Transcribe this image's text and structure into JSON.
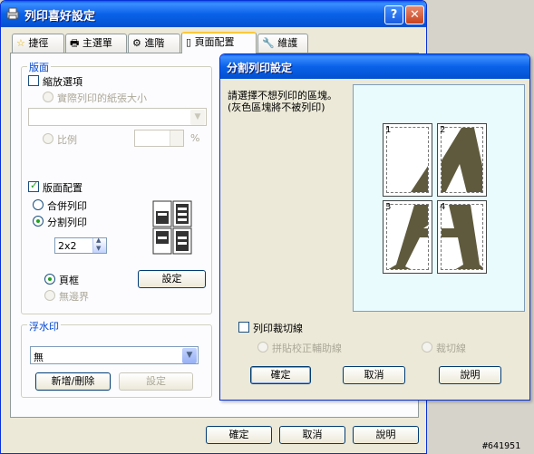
{
  "main_window": {
    "title": "列印喜好設定",
    "tabs": [
      "捷徑",
      "主選單",
      "進階",
      "頁面配置",
      "維護"
    ],
    "layout_group": {
      "title": "版面",
      "scale_option": "縮放選項",
      "actual_paper_size": "實際列印的紙張大小",
      "ratio": "比例",
      "percent_sign": "%",
      "page_layout": "版面配置",
      "n_up": "合併列印",
      "poster": "分割列印",
      "poster_value": "2x2",
      "frame": "頁框",
      "borderless": "無邊界",
      "settings_button": "設定"
    },
    "watermark_group": {
      "title": "浮水印",
      "selected": "無",
      "add_remove_button": "新增/刪除",
      "settings_button": "設定"
    },
    "buttons": {
      "ok": "確定",
      "cancel": "取消",
      "help": "說明"
    }
  },
  "poster_dialog": {
    "title": "分割列印設定",
    "instruction_line1": "請選擇不想列印的區塊。",
    "instruction_line2": "(灰色區塊將不被列印)",
    "tiles": [
      "1",
      "2",
      "3",
      "4"
    ],
    "print_cut_lines": "列印裁切線",
    "overlap_alignment_marks": "拼貼校正輔助線",
    "trim_lines": "裁切線",
    "buttons": {
      "ok": "確定",
      "cancel": "取消",
      "help": "說明"
    }
  },
  "watermark_text": "#641951",
  "colors": {
    "xp_title_blue": "#0a5ddf",
    "preview_bg": "#e9fbfd",
    "glyph": "#5f5a3d"
  }
}
